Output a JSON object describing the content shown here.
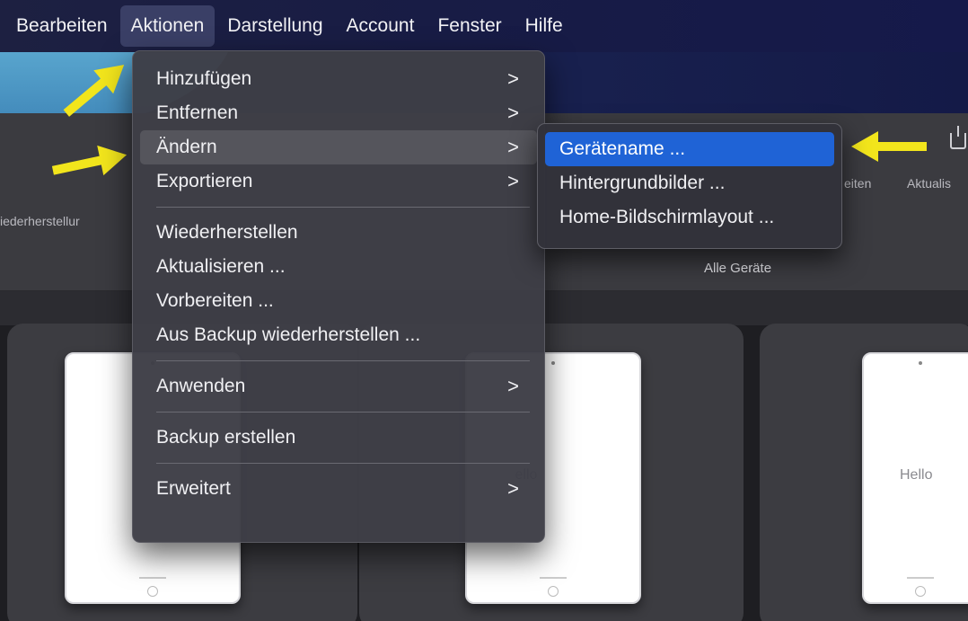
{
  "menubar": {
    "items": [
      "Bearbeiten",
      "Aktionen",
      "Darstellung",
      "Account",
      "Fenster",
      "Hilfe"
    ],
    "active": "Aktionen"
  },
  "toolbar": {
    "left_label": "iederherstellur",
    "right_label_1": "eiten",
    "right_label_2": "Aktualis",
    "all_devices_label": "Alle Geräte",
    "export_icon": "share-icon"
  },
  "devices": {
    "hello_text_1": "ello",
    "hello_text_2": "Hello"
  },
  "actions_menu": {
    "items": [
      {
        "label": "Hinzufügen",
        "submenu": true
      },
      {
        "label": "Entfernen",
        "submenu": true
      },
      {
        "label": "Ändern",
        "submenu": true,
        "highlighted": true
      },
      {
        "label": "Exportieren",
        "submenu": true
      },
      {
        "label": "Wiederherstellen",
        "submenu": false
      },
      {
        "label": "Aktualisieren ...",
        "submenu": false
      },
      {
        "label": "Vorbereiten ...",
        "submenu": false
      },
      {
        "label": "Aus Backup wiederherstellen ...",
        "submenu": false
      },
      {
        "label": "Anwenden",
        "submenu": true
      },
      {
        "label": "Backup erstellen",
        "submenu": false
      },
      {
        "label": "Erweitert",
        "submenu": true
      }
    ],
    "chevron": ">"
  },
  "change_submenu": {
    "items": [
      "Gerätename ...",
      "Hintergrundbilder ...",
      "Home-Bildschirmlayout ..."
    ],
    "selected": "Gerätename ..."
  },
  "colors": {
    "menubar_bg": "#1b1f45",
    "menu_bg": "#3e3e46",
    "selection_blue": "#1f63d6",
    "arrow_yellow": "#f2e51c"
  }
}
